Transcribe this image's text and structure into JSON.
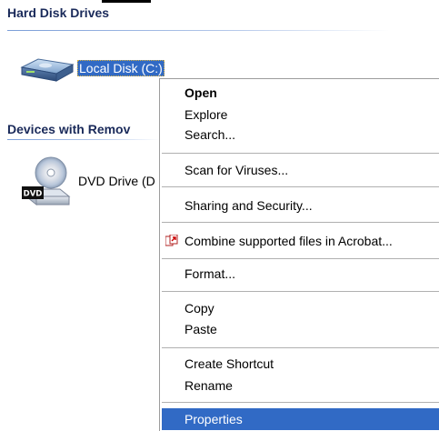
{
  "window": {
    "groups": {
      "hard_disk_drives": "Hard Disk Drives",
      "removable": "Devices with Remov"
    },
    "drives": {
      "local_disk": {
        "label": "Local Disk (C:)",
        "icon": "hard-drive-icon"
      },
      "dvd_drive": {
        "label": "DVD Drive (D",
        "icon": "dvd-drive-icon"
      }
    }
  },
  "context_menu": {
    "open": "Open",
    "explore": "Explore",
    "search": "Search...",
    "scan": "Scan for Viruses...",
    "sharing": "Sharing and Security...",
    "combine": "Combine supported files in Acrobat...",
    "format": "Format...",
    "copy": "Copy",
    "paste": "Paste",
    "shortcut": "Create Shortcut",
    "rename": "Rename",
    "properties": "Properties",
    "selected": "Properties",
    "combine_icon": "acrobat-icon"
  },
  "colors": {
    "selection": "#316ac5",
    "header_text": "#1a2a5a",
    "header_rule": "#7b9ed8"
  }
}
